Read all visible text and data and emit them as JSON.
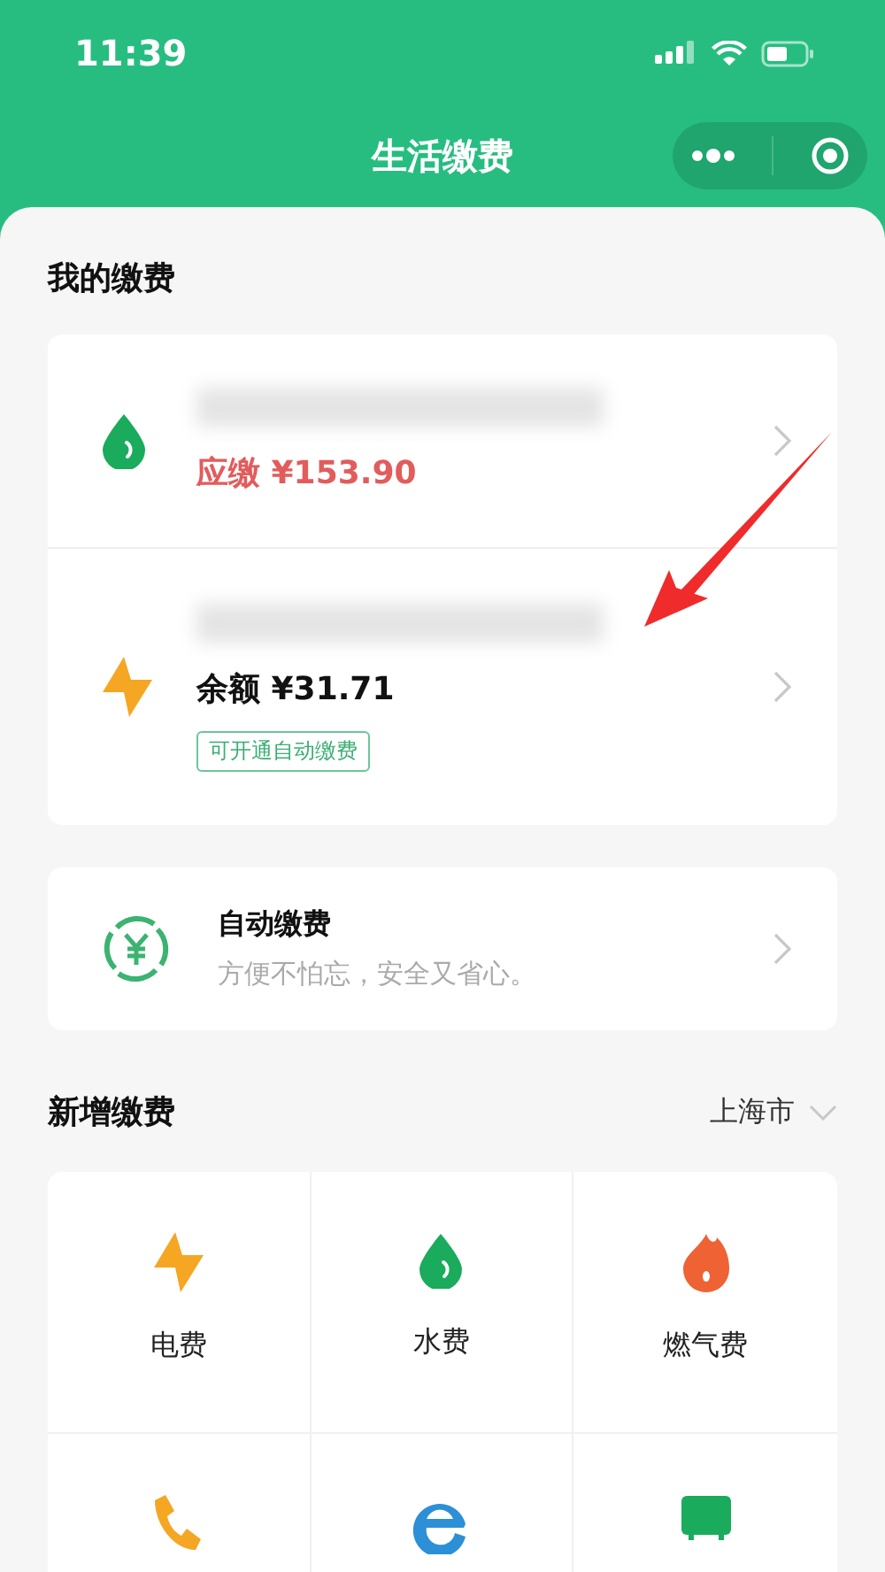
{
  "status_bar": {
    "time": "11:39"
  },
  "nav": {
    "title": "生活缴费"
  },
  "my_bills": {
    "title": "我的缴费",
    "accounts": [
      {
        "kind": "water",
        "amount_label": "应缴 ¥153.90",
        "due": true
      },
      {
        "kind": "electricity",
        "amount_label": "余额 ¥31.71",
        "due": false,
        "tag": "可开通自动缴费"
      }
    ]
  },
  "autopay": {
    "title": "自动缴费",
    "subtitle": "方便不怕忘，安全又省心。"
  },
  "new_bill": {
    "title": "新增缴费",
    "city": "上海市",
    "items": [
      {
        "kind": "electricity",
        "label": "电费"
      },
      {
        "kind": "water",
        "label": "水费"
      },
      {
        "kind": "gas",
        "label": "燃气费"
      },
      {
        "kind": "phone"
      },
      {
        "kind": "broadband"
      },
      {
        "kind": "tv"
      }
    ]
  }
}
